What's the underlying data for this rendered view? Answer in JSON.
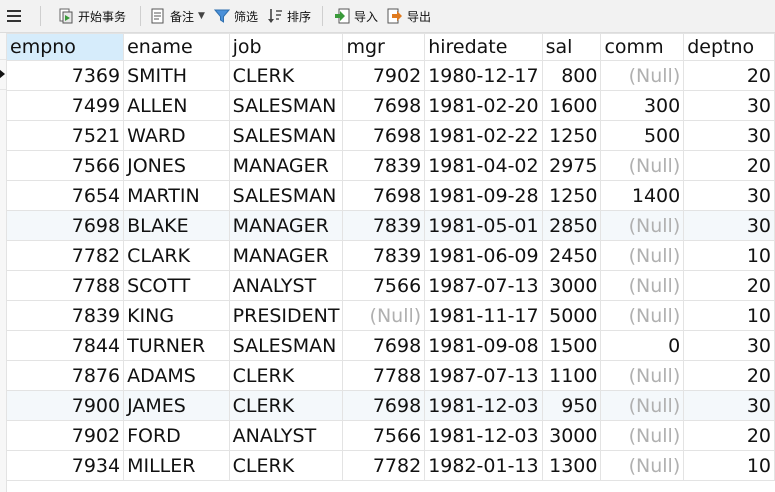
{
  "toolbar": {
    "begin_transaction": "开始事务",
    "memo": "备注",
    "filter": "筛选",
    "sort": "排序",
    "import": "导入",
    "export": "导出"
  },
  "columns": [
    "empno",
    "ename",
    "job",
    "mgr",
    "hiredate",
    "sal",
    "comm",
    "deptno"
  ],
  "rows": [
    [
      "7369",
      "SMITH",
      "CLERK",
      "7902",
      "1980-12-17",
      "800",
      "(Null)",
      "20"
    ],
    [
      "7499",
      "ALLEN",
      "SALESMAN",
      "7698",
      "1981-02-20",
      "1600",
      "300",
      "30"
    ],
    [
      "7521",
      "WARD",
      "SALESMAN",
      "7698",
      "1981-02-22",
      "1250",
      "500",
      "30"
    ],
    [
      "7566",
      "JONES",
      "MANAGER",
      "7839",
      "1981-04-02",
      "2975",
      "(Null)",
      "20"
    ],
    [
      "7654",
      "MARTIN",
      "SALESMAN",
      "7698",
      "1981-09-28",
      "1250",
      "1400",
      "30"
    ],
    [
      "7698",
      "BLAKE",
      "MANAGER",
      "7839",
      "1981-05-01",
      "2850",
      "(Null)",
      "30"
    ],
    [
      "7782",
      "CLARK",
      "MANAGER",
      "7839",
      "1981-06-09",
      "2450",
      "(Null)",
      "10"
    ],
    [
      "7788",
      "SCOTT",
      "ANALYST",
      "7566",
      "1987-07-13",
      "3000",
      "(Null)",
      "20"
    ],
    [
      "7839",
      "KING",
      "PRESIDENT",
      "(Null)",
      "1981-11-17",
      "5000",
      "(Null)",
      "10"
    ],
    [
      "7844",
      "TURNER",
      "SALESMAN",
      "7698",
      "1981-09-08",
      "1500",
      "0",
      "30"
    ],
    [
      "7876",
      "ADAMS",
      "CLERK",
      "7788",
      "1987-07-13",
      "1100",
      "(Null)",
      "20"
    ],
    [
      "7900",
      "JAMES",
      "CLERK",
      "7698",
      "1981-12-03",
      "950",
      "(Null)",
      "30"
    ],
    [
      "7902",
      "FORD",
      "ANALYST",
      "7566",
      "1981-12-03",
      "3000",
      "(Null)",
      "20"
    ],
    [
      "7934",
      "MILLER",
      "CLERK",
      "7782",
      "1982-01-13",
      "1300",
      "(Null)",
      "10"
    ]
  ],
  "colors": {
    "selected_header": "#d6ecfb",
    "null_text": "#b0b0b0",
    "row_alt": "#f4f8fb",
    "filter_icon": "#4a90d9",
    "import_icon": "#3a9a3a",
    "export_icon": "#e07b1f"
  }
}
